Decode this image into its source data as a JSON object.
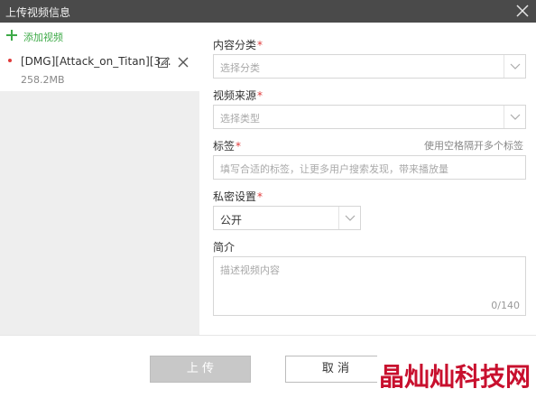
{
  "window": {
    "title": "上传视频信息"
  },
  "sidebar": {
    "add_label": "添加视频",
    "file": {
      "name": "[DMG][Attack_on_Titan][3...",
      "size": "258.2MB"
    }
  },
  "form": {
    "category": {
      "label": "内容分类",
      "required": "*",
      "placeholder": "选择分类"
    },
    "source": {
      "label": "视频来源",
      "required": "*",
      "placeholder": "选择类型"
    },
    "tags": {
      "label": "标签",
      "required": "*",
      "hint": "使用空格隔开多个标签",
      "placeholder": "填写合适的标签，让更多用户搜索发现，带来播放量"
    },
    "privacy": {
      "label": "私密设置",
      "required": "*",
      "value": "公开"
    },
    "intro": {
      "label": "简介",
      "placeholder": "描述视频内容",
      "counter": "0/140"
    }
  },
  "footer": {
    "upload_label": "上 传",
    "cancel_label": "取 消"
  },
  "watermark": {
    "text": "晶灿灿科技网"
  },
  "colors": {
    "accent_green": "#3eaa48",
    "required_red": "#e03b3b",
    "titlebar": "#4a4a4a",
    "watermark": "#c8102e"
  },
  "icons": [
    "close-icon",
    "plus-icon",
    "edit-icon",
    "remove-icon",
    "chevron-down-icon"
  ]
}
